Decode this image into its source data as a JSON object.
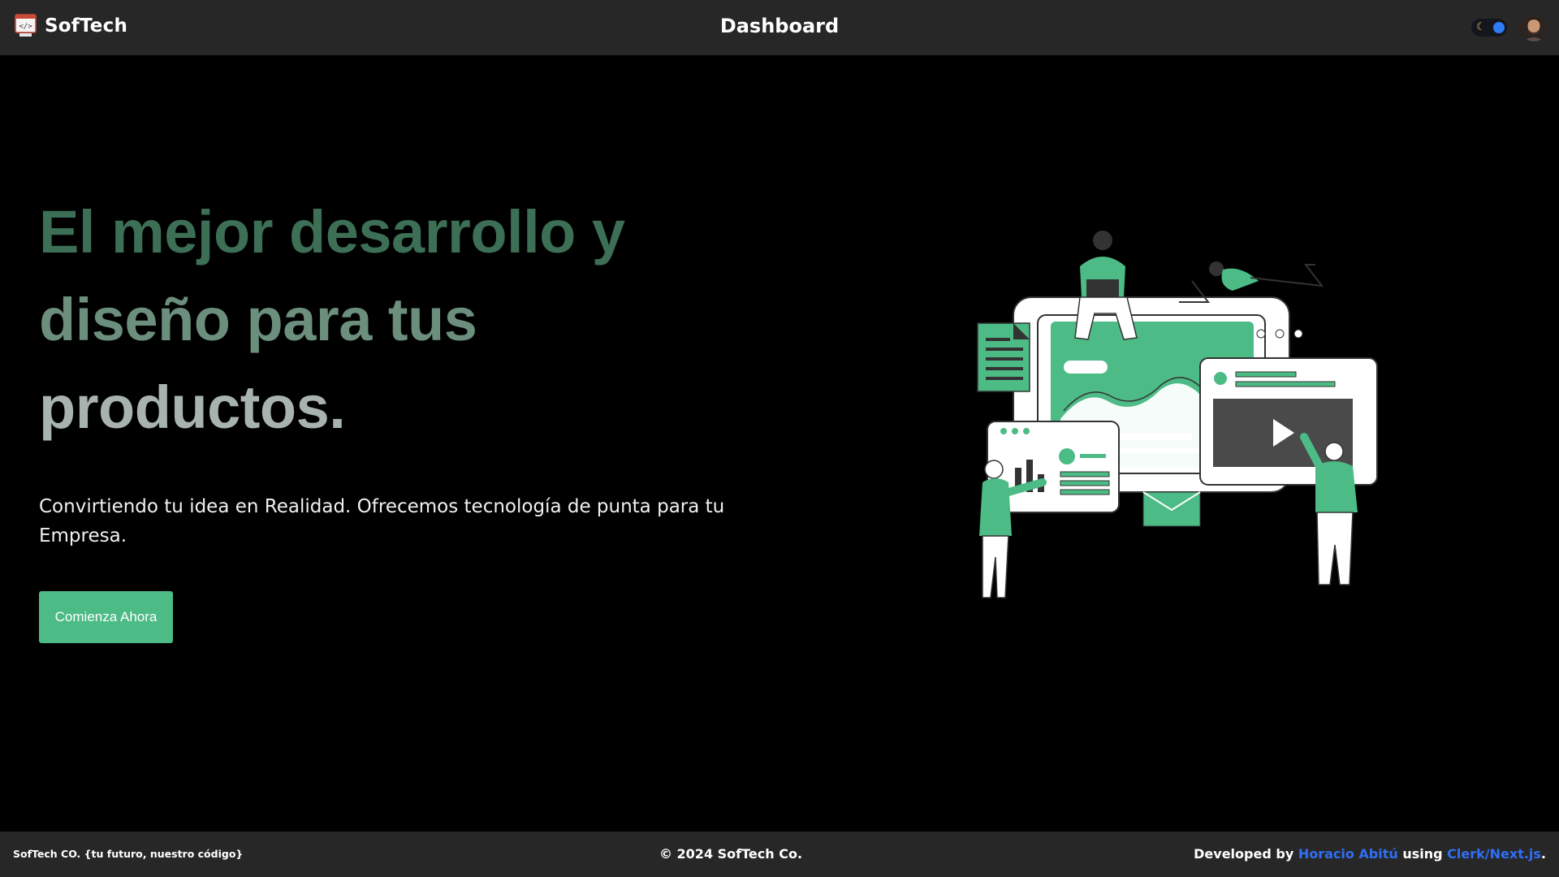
{
  "header": {
    "brand": "SofTech",
    "title": "Dashboard",
    "theme_icon": "moon-icon",
    "avatar_icon": "user-avatar"
  },
  "hero": {
    "title_line1": "El mejor desarrollo y",
    "title_line2": "diseño para tus",
    "title_line3": "productos.",
    "subtitle": "Convirtiendo tu idea en Realidad. Ofrecemos tecnología de punta para tu Empresa.",
    "cta_label": "Comienza Ahora"
  },
  "footer": {
    "left": "SofTech CO. {tu futuro, nuestro código}",
    "center": "© 2024 SofTech Co.",
    "right_prefix": "Developed by ",
    "author": "Horacio Abitú",
    "right_mid": " using ",
    "tech": "Clerk/Next.js",
    "right_suffix": "."
  },
  "colors": {
    "bar": "#272727",
    "accent": "#4cbb86",
    "link": "#2f6ff5",
    "title_dark": "#3c6f55",
    "title_mid": "#6b8f7c",
    "title_light": "#a9b3ae"
  }
}
